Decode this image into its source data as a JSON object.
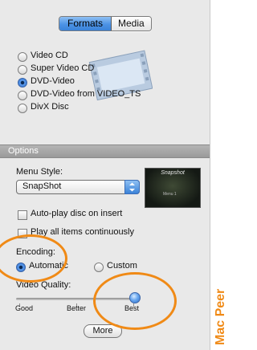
{
  "tabs": {
    "formats": "Formats",
    "media": "Media"
  },
  "disc_formats": [
    {
      "label": "Video CD",
      "selected": false
    },
    {
      "label": "Super Video CD",
      "selected": false
    },
    {
      "label": "DVD-Video",
      "selected": true
    },
    {
      "label": "DVD-Video from VIDEO_TS",
      "selected": false
    },
    {
      "label": "DivX Disc",
      "selected": false
    }
  ],
  "options": {
    "header": "Options",
    "menu_style_label": "Menu Style:",
    "menu_style_value": "SnapShot",
    "thumbnail_title": "Snapshot",
    "thumbnail_caption": "Menu 1",
    "autoplay_label": "Auto-play disc on insert",
    "play_all_label": "Play all items continuously",
    "encoding_label": "Encoding:",
    "encoding_automatic": "Automatic",
    "encoding_custom": "Custom",
    "video_quality_label": "Video Quality:",
    "quality_good": "Good",
    "quality_better": "Better",
    "quality_best": "Best",
    "quality_value": "Best",
    "more_button": "More"
  },
  "watermark": "Mac Peer",
  "colors": {
    "accent_blue": "#3b82d8",
    "annotation_orange": "#f08a16"
  }
}
